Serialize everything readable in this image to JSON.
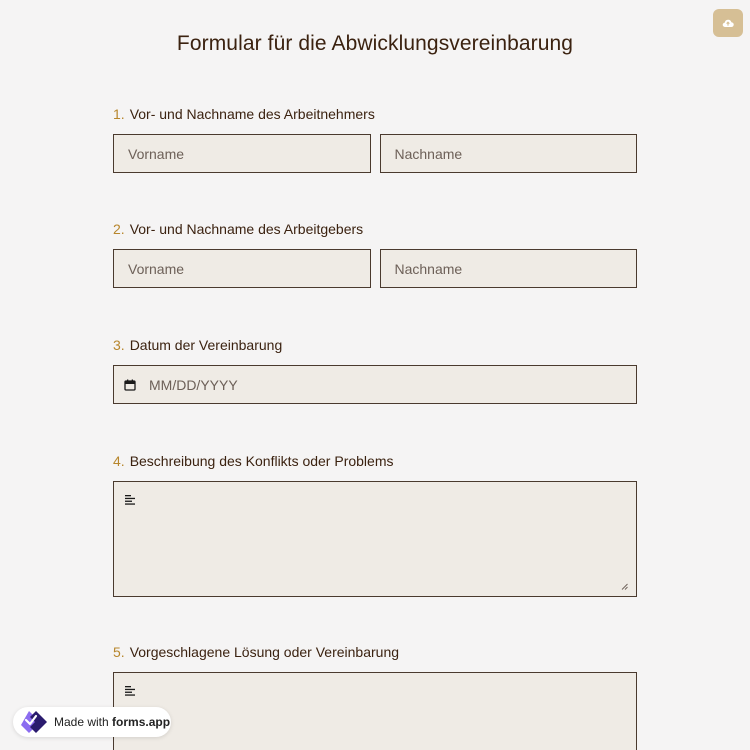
{
  "title": "Formular für die Abwicklungsvereinbarung",
  "questions": [
    {
      "number": "1.",
      "label": "Vor- und Nachname des Arbeitnehmers",
      "first_placeholder": "Vorname",
      "last_placeholder": "Nachname"
    },
    {
      "number": "2.",
      "label": "Vor- und Nachname des Arbeitgebers",
      "first_placeholder": "Vorname",
      "last_placeholder": "Nachname"
    },
    {
      "number": "3.",
      "label": "Datum der Vereinbarung",
      "placeholder": "MM/DD/YYYY"
    },
    {
      "number": "4.",
      "label": "Beschreibung des Konflikts oder Problems"
    },
    {
      "number": "5.",
      "label": "Vorgeschlagene Lösung oder Vereinbarung"
    }
  ],
  "badge": {
    "prefix": "Made with",
    "brand": "forms.app"
  },
  "colors": {
    "accent": "#b7862c",
    "button": "#d6bf95",
    "field_bg": "#efebe5",
    "border": "#4a3a2e",
    "text": "#3b2210"
  }
}
